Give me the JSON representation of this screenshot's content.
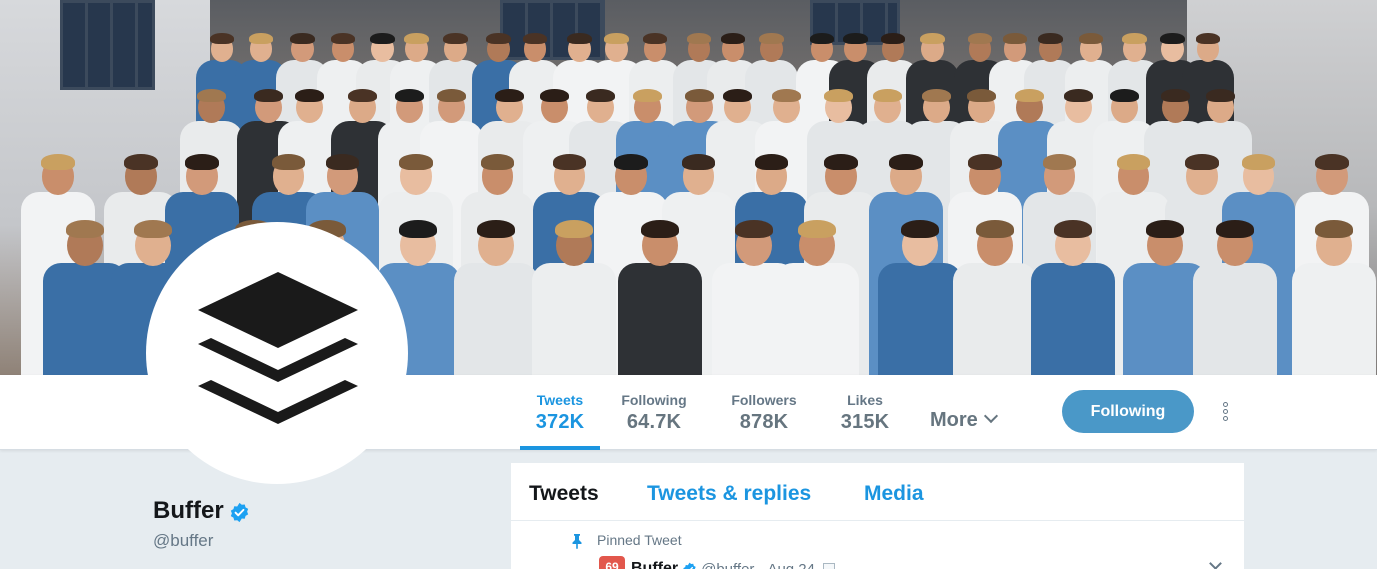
{
  "header_photo": {
    "alt": ""
  },
  "profile": {
    "name": "Buffer",
    "handle": "@buffer",
    "verified": true
  },
  "stats": [
    {
      "label": "Tweets",
      "value": "372K",
      "active": true
    },
    {
      "label": "Following",
      "value": "64.7K",
      "active": false
    },
    {
      "label": "Followers",
      "value": "878K",
      "active": false
    },
    {
      "label": "Likes",
      "value": "315K",
      "active": false
    }
  ],
  "more_label": "More",
  "follow_button_label": "Following",
  "tabs": [
    {
      "label": "Tweets",
      "active": true
    },
    {
      "label": "Tweets & replies",
      "active": false
    },
    {
      "label": "Media",
      "active": false
    }
  ],
  "pinned_tweet": {
    "pinned_label": "Pinned Tweet",
    "avatar_text": "69",
    "author_name": "Buffer",
    "author_handle": "@buffer",
    "separator": "·",
    "date": "Aug 24"
  },
  "colors": {
    "accent": "#1b95e0",
    "follow_button": "#4a98c8",
    "background": "#e6ecf0",
    "verified_badge": "#1da1f2"
  },
  "icons": {
    "verified": "verified-badge-icon",
    "pin": "pin-icon",
    "more": "chevron-down-icon",
    "kebab": "more-vertical-icon",
    "caret": "caret-down-icon"
  }
}
